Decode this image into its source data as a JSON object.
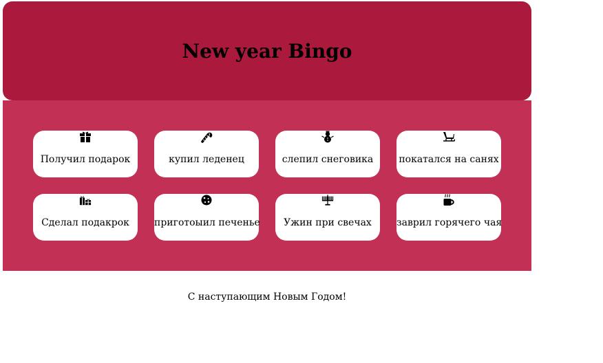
{
  "header": {
    "title": "New year Bingo"
  },
  "colors": {
    "header_bg": "#ab1a3c",
    "board_bg": "#c23055",
    "cell_bg": "#ffffff"
  },
  "cells": [
    {
      "icon": "gift-icon",
      "label": "Получил подарок"
    },
    {
      "icon": "candy-cane-icon",
      "label": "купил леденец"
    },
    {
      "icon": "snowman-icon",
      "label": "слепил снеговика"
    },
    {
      "icon": "sleigh-icon",
      "label": "покатался на санях"
    },
    {
      "icon": "gifts-icon",
      "label": "Сделал подакрок"
    },
    {
      "icon": "cookie-icon",
      "label": "приготоыил печенье"
    },
    {
      "icon": "menorah-icon",
      "label": "Ужин при свечах"
    },
    {
      "icon": "mug-hot-icon",
      "label": "заврил горячего чая"
    }
  ],
  "footer": {
    "text": "С наступающим Новым Годом!"
  }
}
